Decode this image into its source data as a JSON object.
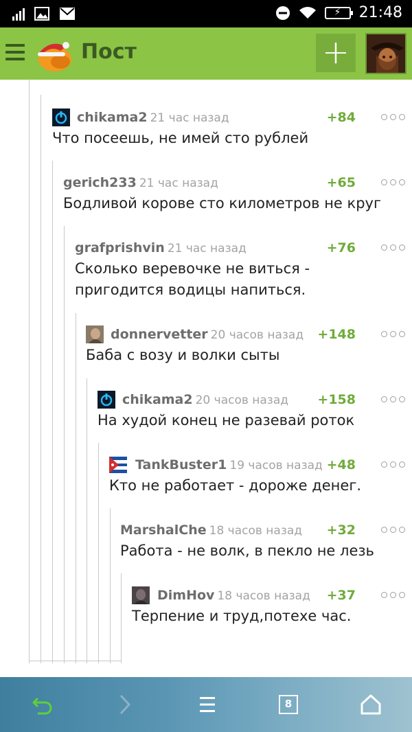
{
  "status_bar": {
    "time": "21:48"
  },
  "app_bar": {
    "title": "Пост",
    "add_label": "+"
  },
  "comments": [
    {
      "user": "chikama2",
      "time": "21 час назад",
      "score": "+84",
      "text": "Что посеешь, не имей сто рублей",
      "avatar": "power-icon"
    },
    {
      "user": "gerich233",
      "time": "21 час назад",
      "score": "+65",
      "text": "Бодливой корове сто километров не круг",
      "avatar": ""
    },
    {
      "user": "grafprishvin",
      "time": "21 час назад",
      "score": "+76",
      "text": "Сколько веревочке не виться - пригодится водицы напиться.",
      "avatar": ""
    },
    {
      "user": "donnervetter",
      "time": "20 часов назад",
      "score": "+148",
      "text": "Баба с возу и волки сыты",
      "avatar": "photo"
    },
    {
      "user": "chikama2",
      "time": "20 часов назад",
      "score": "+158",
      "text": "На худой конец не разевай роток",
      "avatar": "power-icon"
    },
    {
      "user": "TankBuster1",
      "time": "19 часов назад",
      "score": "+48",
      "text": "Кто не работает - дороже денег.",
      "avatar": "flag-icon"
    },
    {
      "user": "MarshalChe",
      "time": "18 часов назад",
      "score": "+32",
      "text": "Работа - не волк, в пекло не лезь",
      "avatar": ""
    },
    {
      "user": "DimHov",
      "time": "18 часов назад",
      "score": "+37",
      "text": "Терпение и труд,потехе час.",
      "avatar": "photo"
    }
  ],
  "bottom_bar": {
    "tabs_count": "8"
  },
  "colors": {
    "accent": "#8cc445",
    "score": "#6fab3a",
    "title": "#3b5a22"
  }
}
